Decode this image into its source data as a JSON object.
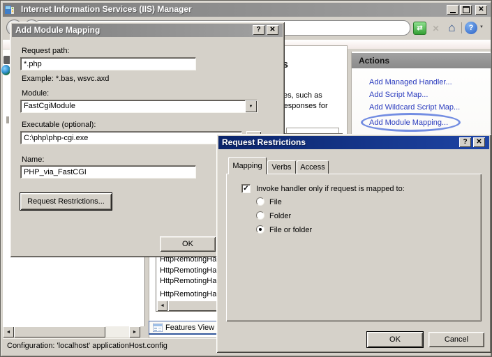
{
  "colors": {
    "face": "#d5d1c9",
    "link_blue": "#2b3cbe",
    "active_title_start": "#0a246a",
    "active_title_end": "#1e44a4",
    "inactive_title_start": "#7d7d7d",
    "inactive_title_end": "#a2a2a2",
    "annotation_blue": "#5b79dd"
  },
  "icons": {
    "dialog_help": "?",
    "window_close": "✕",
    "combo_arrow": "▼",
    "dropdown_caret": "▼",
    "help_question": "?",
    "refresh": "⇄",
    "stop": "✕",
    "home": "⌂",
    "scroll_left": "◄",
    "scroll_right": "►",
    "check": "✓"
  },
  "main_window": {
    "title": "Internet Information Services (IIS) Manager",
    "status_bar": "Configuration: 'localhost' applicationHost.config",
    "features_view_tab": "Features View",
    "content": {
      "heading_fragment": "s",
      "desc_line1": "tes, such as",
      "desc_line2": "responses for",
      "list_rows": [
        "HttpRemotingHa",
        "HttpRemotingHa",
        "HttpRemotingHa",
        "HttpRemotingHa"
      ]
    },
    "actions": {
      "header": "Actions",
      "links": [
        "Add Managed Handler...",
        "Add Script Map...",
        "Add Wildcard Script Map...",
        "Add Module Mapping..."
      ]
    }
  },
  "add_module_mapping": {
    "title": "Add Module Mapping",
    "request_path_label": "Request path:",
    "request_path_value": "*.php",
    "example_text": "Example: *.bas, wsvc.axd",
    "module_label": "Module:",
    "module_value": "FastCgiModule",
    "executable_label": "Executable (optional):",
    "executable_value": "C:\\php\\php-cgi.exe",
    "browse_button": "...",
    "name_label": "Name:",
    "name_value": "PHP_via_FastCGI",
    "request_restrictions_button": "Request Restrictions...",
    "ok_button": "OK"
  },
  "request_restrictions": {
    "title": "Request Restrictions",
    "tabs": [
      "Mapping",
      "Verbs",
      "Access"
    ],
    "invoke_checkbox_label": "Invoke handler only if request is mapped to:",
    "invoke_checkbox_checked": true,
    "radio_options": [
      "File",
      "Folder",
      "File or folder"
    ],
    "selected_option": "File or folder",
    "ok_button": "OK",
    "cancel_button": "Cancel"
  }
}
